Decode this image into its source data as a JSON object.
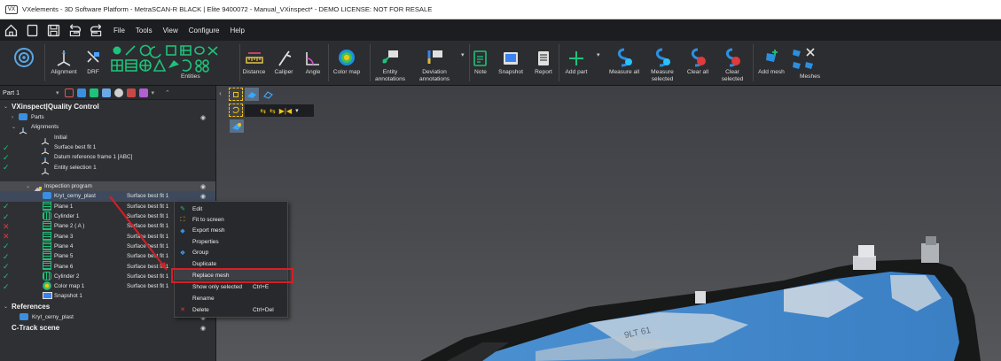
{
  "window": {
    "title": "VXelements - 3D Software Platform - MetraSCAN-R BLACK | Elite 9400072 - Manual_VXinspect* - DEMO LICENSE: NOT FOR RESALE",
    "app_icon_text": "VX"
  },
  "menubar": {
    "items": [
      "File",
      "Tools",
      "View",
      "Configure",
      "Help"
    ]
  },
  "ribbon": {
    "alignment": "Alignment",
    "drf": "DRF",
    "entities": "Entities",
    "distance": "Distance",
    "caliper": "Caliper",
    "angle": "Angle",
    "color_map": "Color map",
    "entity_annotations": "Entity annotations",
    "deviation_annotations": "Deviation annotations",
    "note": "Note",
    "snapshot": "Snapshot",
    "report": "Report",
    "add_part": "Add part",
    "measure_all": "Measure all",
    "measure_selected": "Measure selected",
    "clear_all": "Clear all",
    "clear_selected": "Clear selected",
    "add_mesh": "Add mesh",
    "meshes": "Meshes"
  },
  "panel": {
    "selector": "Part 1",
    "tree": [
      {
        "text": "VXinspect|Quality Control",
        "kind": "header"
      },
      {
        "text": "Parts"
      },
      {
        "text": "Alignments"
      },
      {
        "text": "Initial"
      },
      {
        "text": "Surface best fit 1"
      },
      {
        "text": "Datum reference frame 1 [ABC]"
      },
      {
        "text": "Entity selection 1"
      },
      {
        "text": "Inspection program"
      },
      {
        "text": "Kryt_cerny_plast",
        "col2": "Surface best fit 1"
      },
      {
        "text": "Plane 1",
        "col2": "Surface best fit 1"
      },
      {
        "text": "Cylinder 1",
        "col2": "Surface best fit 1"
      },
      {
        "text": "Plane 2 ( A )",
        "col2": "Surface best fit 1"
      },
      {
        "text": "Plane 3",
        "col2": "Surface best fit 1"
      },
      {
        "text": "Plane 4",
        "col2": "Surface best fit 1"
      },
      {
        "text": "Plane 5",
        "col2": "Surface best fit 1"
      },
      {
        "text": "Plane 6",
        "col2": "Surface best fit 1"
      },
      {
        "text": "Cylinder 2",
        "col2": "Surface best fit 1"
      },
      {
        "text": "Color map 1",
        "col2": "Surface best fit 1"
      },
      {
        "text": "Snapshot 1"
      },
      {
        "text": "References",
        "kind": "header"
      },
      {
        "text": "Kryt_cerny_plast"
      },
      {
        "text": "C-Track scene",
        "kind": "header"
      }
    ]
  },
  "context_menu": {
    "items": [
      {
        "label": "Edit",
        "shortcut": ""
      },
      {
        "label": "Fit to screen",
        "shortcut": ""
      },
      {
        "label": "Export mesh",
        "shortcut": ""
      },
      {
        "label": "Properties",
        "shortcut": ""
      },
      {
        "label": "Group",
        "shortcut": ""
      },
      {
        "label": "Duplicate",
        "shortcut": ""
      },
      {
        "label": "Replace mesh",
        "shortcut": ""
      },
      {
        "label": "Show only selected",
        "shortcut": "Ctrl+E"
      },
      {
        "label": "Rename",
        "shortcut": ""
      },
      {
        "label": "Delete",
        "shortcut": "Ctrl+Del"
      }
    ]
  },
  "viewport": {
    "model_label": "9LT 61"
  },
  "colors": {
    "highlight": "#d61f26",
    "model_blue": "#3d8fd6",
    "menubar": "#1c1d20",
    "ribbon": "#2c2d30"
  }
}
